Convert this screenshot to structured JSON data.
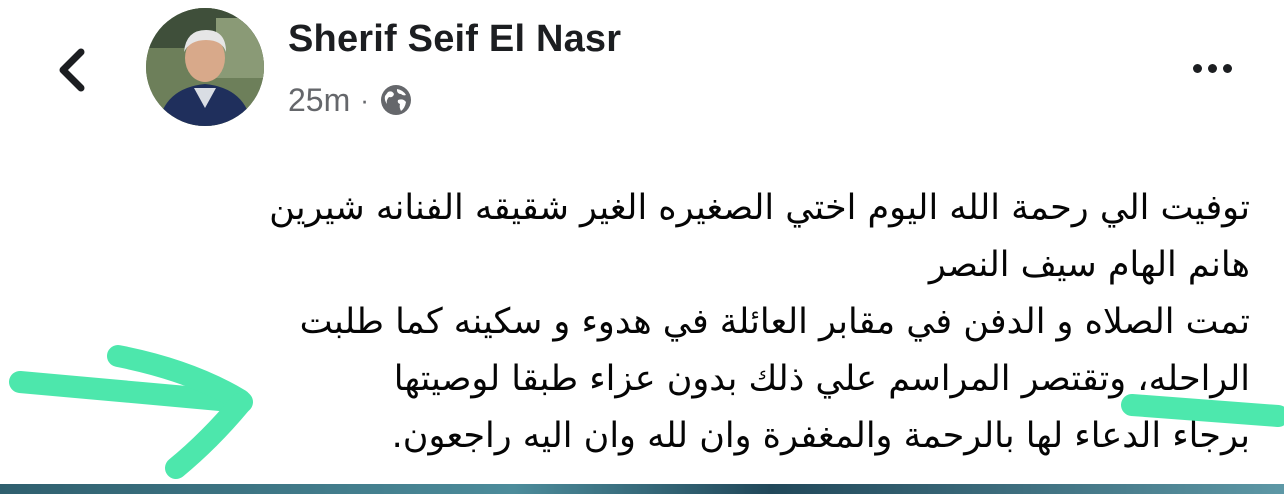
{
  "post": {
    "author": "Sherif Seif El Nasr",
    "time": "25m",
    "separator": "·",
    "privacy_icon": "globe-icon",
    "lines": [
      "توفيت الي رحمة الله اليوم اختي الصغيره الغير شقيقه الفنانه شيرين",
      "هانم الهام سيف النصر",
      "تمت الصلاه و الدفن في مقابر العائلة في هدوء و سكينه كما طلبت",
      "الراحله، وتقتصر المراسم علي ذلك بدون عزاء طبقا لوصيتها",
      "برجاء الدعاء لها بالرحمة والمغفرة وان لله وان اليه راجعون."
    ]
  },
  "icons": {
    "back": "chevron-left-icon",
    "more": "more-horizontal-icon"
  },
  "colors": {
    "text": "#050505",
    "meta": "#65676b",
    "annotation": "#3ee6a6"
  }
}
